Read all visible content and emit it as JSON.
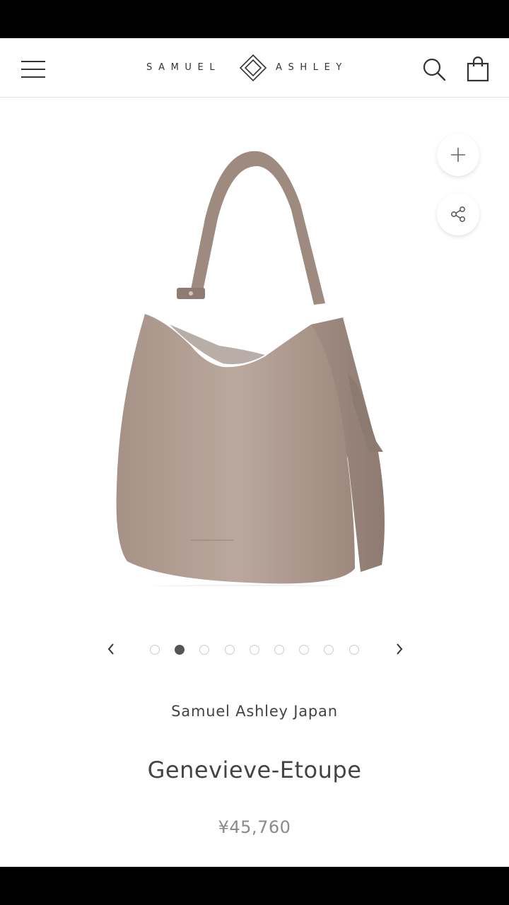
{
  "header": {
    "logo_left": "SAMUEL",
    "logo_right": "ASHLEY"
  },
  "gallery": {
    "slide_count": 9,
    "active_slide": 2
  },
  "product": {
    "vendor": "Samuel Ashley Japan",
    "title": "Genevieve-Etoupe",
    "price": "¥45,760"
  },
  "icons": {
    "menu": "hamburger-menu-icon",
    "search": "search-icon",
    "cart": "shopping-bag-icon",
    "zoom": "plus-icon",
    "share": "share-icon",
    "prev": "chevron-left-icon",
    "next": "chevron-right-icon"
  },
  "colors": {
    "bag": "#b3a095",
    "text": "#444444",
    "price": "#8a8a8a",
    "active_dot": "#555555"
  }
}
